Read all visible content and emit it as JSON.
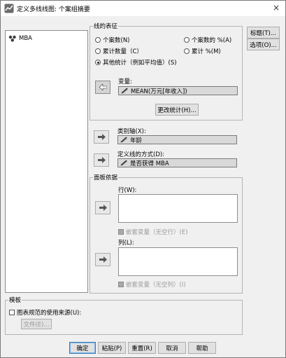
{
  "window": {
    "title": "定义多线线图: 个案组摘要",
    "close_label": "×"
  },
  "variables": [
    {
      "label": "MBA",
      "icon": "nominal-variable-icon"
    }
  ],
  "line_represents": {
    "group_label": "线的表征",
    "options": [
      {
        "label": "个案数(N)",
        "selected": false
      },
      {
        "label": "个案数的 %(A)",
        "selected": false
      },
      {
        "label": "累计数量（C）",
        "selected": false
      },
      {
        "label": "累计 %(M)",
        "selected": false
      },
      {
        "label": "其他统计（例如平均值）(S)",
        "selected": true
      }
    ],
    "variable_label": "变量:",
    "variable_value": "MEAN(万元[年收入])",
    "change_stat_button": "更改统计(H)..."
  },
  "category_axis": {
    "label": "类别轴(X):",
    "value": "年龄"
  },
  "lines_defined_by": {
    "label": "定义线的方式(D):",
    "value": "是否获得 MBA"
  },
  "panel_by": {
    "group_label": "面板依据",
    "rows_label": "行(W):",
    "nest_rows_label": "嵌套变量（无空行）(E)",
    "cols_label": "列(L):",
    "nest_cols_label": "嵌套变量（无空列）(I)"
  },
  "template": {
    "group_label": "模板",
    "use_chart_spec_label": "图表规范的使用来源(U):",
    "file_button": "文件(E)..."
  },
  "side_buttons": {
    "titles": "标题(T)...",
    "options": "选项(O)..."
  },
  "bottom_buttons": {
    "ok": "确定",
    "paste": "粘贴(P)",
    "reset": "重置(R)",
    "cancel": "取消",
    "help": "帮助"
  }
}
